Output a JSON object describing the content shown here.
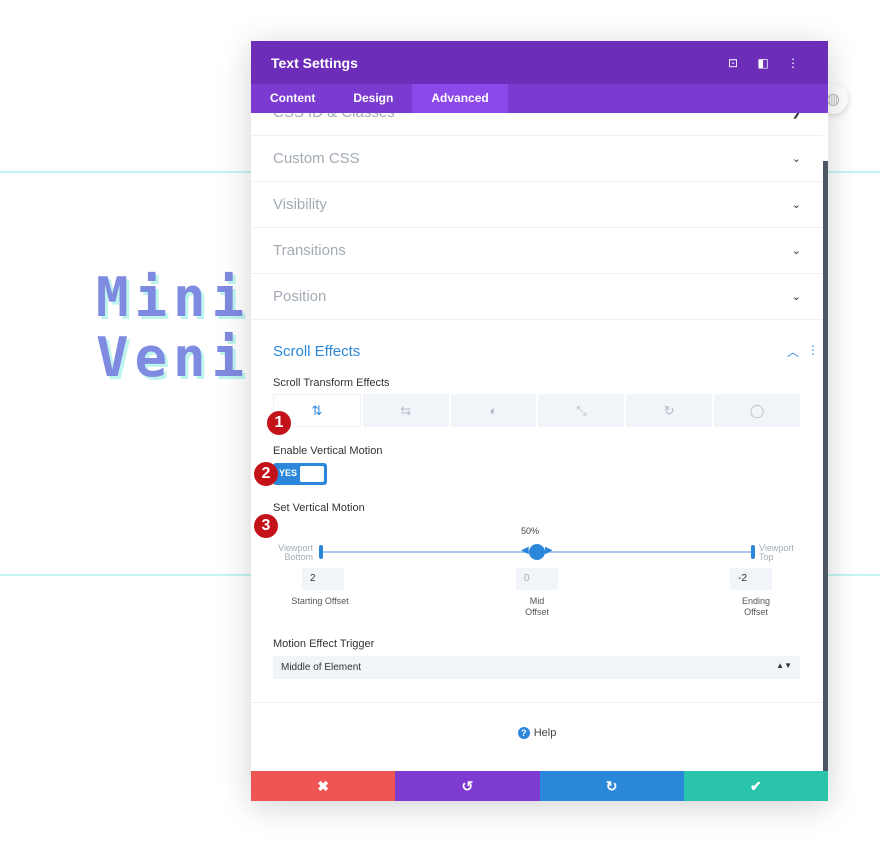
{
  "background": {
    "text_line1": "Mini",
    "text_line2": "Veni"
  },
  "modal": {
    "title": "Text Settings",
    "header_icons": [
      "expand-icon",
      "sidebar-icon",
      "more-icon"
    ],
    "tabs": [
      {
        "label": "Content"
      },
      {
        "label": "Design"
      },
      {
        "label": "Advanced",
        "active": true
      }
    ],
    "sections": [
      {
        "label": "CSS ID & Classes"
      },
      {
        "label": "Custom CSS"
      },
      {
        "label": "Visibility"
      },
      {
        "label": "Transitions"
      },
      {
        "label": "Position"
      }
    ],
    "scroll_effects": {
      "title": "Scroll Effects",
      "transform_label": "Scroll Transform Effects",
      "transform_buttons": [
        "vertical-motion-icon",
        "horizontal-motion-icon",
        "fade-icon",
        "scale-icon",
        "rotate-icon",
        "blur-icon"
      ],
      "enable_label": "Enable Vertical Motion",
      "toggle": "YES",
      "set_label": "Set Vertical Motion",
      "mid_percent": "50%",
      "viewport_bottom": "Viewport Bottom",
      "viewport_top": "Viewport Top",
      "starting_offset": "2",
      "mid_offset": "0",
      "ending_offset": "-2",
      "starting_label": "Starting Offset",
      "mid_label": "Mid Offset",
      "ending_label": "Ending Offset",
      "trigger_label": "Motion Effect Trigger",
      "trigger_value": "Middle of Element"
    },
    "badges": [
      "1",
      "2",
      "3"
    ],
    "help": "Help",
    "footer": {
      "cancel": "✖",
      "undo": "↺",
      "redo": "↻",
      "save": "✔"
    },
    "colors": {
      "header": "#6c2eb9",
      "tabs": "#7b3bd0",
      "accent": "#2b87da",
      "cancel": "#ef5555",
      "undo": "#7e3bd0",
      "redo": "#2b87da",
      "save": "#29c4a9"
    }
  }
}
